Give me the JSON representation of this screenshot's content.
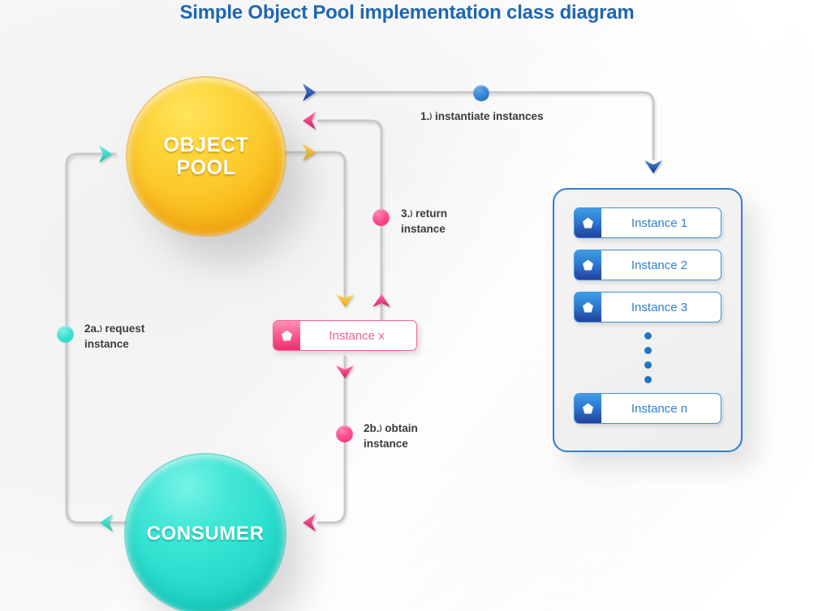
{
  "page": {
    "title": "Simple Object Pool implementation class diagram",
    "title_color": "#1f66b0",
    "background_color": "#f4f4f4"
  },
  "nodes": {
    "pool": {
      "line1": "OBJECT",
      "line2": "POOL",
      "color": "#fbc92a"
    },
    "consumer": {
      "label": "CONSUMER",
      "color": "#2ee0cf"
    }
  },
  "instances_panel": {
    "border_color": "#2f7fd0",
    "icon_color": "#23409d",
    "text_color": "#2f7fd0",
    "items": [
      {
        "label": "Instance 1",
        "icon": "pentagon-icon"
      },
      {
        "label": "Instance 2",
        "icon": "pentagon-icon"
      },
      {
        "label": "Instance 3",
        "icon": "pentagon-icon"
      },
      {
        "label": "Instance n",
        "icon": "pentagon-icon"
      }
    ],
    "ellipsis_dots": 4,
    "ellipsis_color": "#1f77c4"
  },
  "instance_x": {
    "label": "Instance x",
    "icon": "pentagon-icon",
    "color": "#f2619a"
  },
  "steps": [
    {
      "id": "step-1",
      "number": "1.",
      "paren": ")",
      "text": "instantiate instances",
      "dot_color": "#3a8ad8",
      "dot_type": "blue"
    },
    {
      "id": "step-2a",
      "number": "2a.",
      "paren": ")",
      "line1": "request",
      "line2": "instance",
      "dot_color": "#3ee2d2",
      "dot_type": "teal"
    },
    {
      "id": "step-2b",
      "number": "2b.",
      "paren": ")",
      "line1": "obtain",
      "line2": "instance",
      "dot_color": "#fb4e8d",
      "dot_type": "pink"
    },
    {
      "id": "step-3",
      "number": "3.",
      "paren": ")",
      "line1": "return",
      "line2": "instance",
      "dot_color": "#fb4e8d",
      "dot_type": "pink"
    }
  ],
  "arrows": [
    {
      "name": "arrow-pool-to-instances",
      "direction": "right",
      "color": "#1f4fa8"
    },
    {
      "name": "arrow-instances-into-panel",
      "direction": "down",
      "color": "#1f4fa8"
    },
    {
      "name": "arrow-return-into-pool",
      "direction": "left",
      "color": "#ee2f74"
    },
    {
      "name": "arrow-pool-to-instancex",
      "direction": "right",
      "color": "#f5b729"
    },
    {
      "name": "arrow-request-into-pool",
      "direction": "right",
      "color": "#2ed8c8"
    },
    {
      "name": "arrow-down-to-instancex",
      "direction": "down",
      "color": "#f5b729"
    },
    {
      "name": "arrow-up-from-instancex",
      "direction": "up",
      "color": "#ee2f74"
    },
    {
      "name": "arrow-down-from-instancex",
      "direction": "down",
      "color": "#ee2f74"
    },
    {
      "name": "arrow-into-consumer-left",
      "direction": "left",
      "color": "#2ed8c8"
    },
    {
      "name": "arrow-into-consumer-right",
      "direction": "left",
      "color": "#ee2f74"
    }
  ],
  "wire_color": "#c9c9c9"
}
